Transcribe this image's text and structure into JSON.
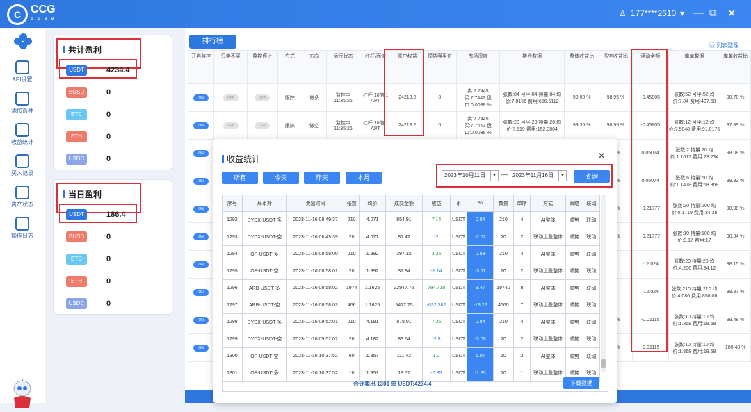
{
  "app": {
    "logo": "CCG",
    "version": "6.1.3.9",
    "user": "177****2610",
    "brand_color": "#2f78e0",
    "alert_color": "#d9303a"
  },
  "nav": [
    {
      "label": "API设置",
      "icon": "gear-icon"
    },
    {
      "label": "添加币种",
      "icon": "coin-add-icon"
    },
    {
      "label": "收益统计",
      "icon": "chart-icon"
    },
    {
      "label": "买入记录",
      "icon": "record-icon"
    },
    {
      "label": "资产状态",
      "icon": "wallet-icon"
    },
    {
      "label": "操作日志",
      "icon": "log-icon"
    }
  ],
  "total_profit": {
    "title": "共计盈利",
    "coins": [
      {
        "name": "USDT",
        "value": "4234.4",
        "color": "#2f78e0"
      },
      {
        "name": "BUSD",
        "value": "0",
        "color": "#f07b6b"
      },
      {
        "name": "BTC",
        "value": "0",
        "color": "#69c7f2"
      },
      {
        "name": "ETH",
        "value": "0",
        "color": "#f07b6b"
      },
      {
        "name": "USDC",
        "value": "0",
        "color": "#8aa5e8"
      }
    ]
  },
  "today_profit": {
    "title": "当日盈利",
    "coins": [
      {
        "name": "USDT",
        "value": "186.4",
        "color": "#2f78e0"
      },
      {
        "name": "BUSD",
        "value": "0",
        "color": "#f07b6b"
      },
      {
        "name": "BTC",
        "value": "0",
        "color": "#69c7f2"
      },
      {
        "name": "ETH",
        "value": "0",
        "color": "#f07b6b"
      },
      {
        "name": "USDC",
        "value": "0",
        "color": "#8aa5e8"
      }
    ]
  },
  "main": {
    "rank_button": "排行榜",
    "list_view": "列表整理",
    "headers": [
      "开启监控",
      "只卖不买",
      "监控停止",
      "方式",
      "方向",
      "运行状态",
      "杠杆/面值",
      "账户权益",
      "预估强平价",
      "市场深度",
      "持仓数据",
      "整体收益比",
      "多空收益比",
      "浮动金额",
      "库单数据",
      "库单收益比"
    ],
    "rows": [
      {
        "mode": "跟踪",
        "dir": "做多",
        "status": "监控中 11:35:26",
        "lev": "杠杆:10倍 1 APT",
        "equity": "24213.2",
        "liq": "0",
        "depth": "卖:7.7445 买:7.7442 盘口:0.0038 %",
        "pos": "张数:84 可平:84 持量:84 均价:7.8156 费用:656.5112",
        "ratio": "99.09 %",
        "ls": "98.95 %",
        "float": "-0.45805",
        "stock": "张数:52 可平:52 均价:7.84 费用:407.68",
        "sr": "98.78 %"
      },
      {
        "mode": "跟踪",
        "dir": "做空",
        "status": "监控中 11:35:26",
        "lev": "杠杆:10倍 1 APT",
        "equity": "24213.2",
        "liq": "0",
        "depth": "卖:7.7445 买:7.7442 盘口:0.0038 %",
        "pos": "张数:20 可平:20 持量:20 均价:7.619 费用:152.3804",
        "ratio": "99.35 %",
        "ls": "98.95 %",
        "float": "-0.45805",
        "stock": "张数:12 可平:12 均价:7.5848 费用:91.0176",
        "sr": "97.89 %"
      },
      {
        "ls": "4 %",
        "float": "0.05074",
        "stock": "张数:2 持量:20 均价:1.1617 费用:23.234",
        "sr": "98.08 %"
      },
      {
        "ls": "4 %",
        "float": "0.05074",
        "stock": "张数:6 持量:60 均价:1.1478 费用:68.868",
        "sr": "99.93 %"
      },
      {
        "ls": "3 %",
        "float": "-0.21777",
        "stock": "张数:20 持量:200 均价:0.1719 费用:34.38",
        "sr": "98.08 %"
      },
      {
        "ls": "3 %",
        "float": "-0.21777",
        "stock": "张数:10 持量:100 均价:0.17 费用:17",
        "sr": "98.84 %"
      },
      {
        "ls": "",
        "float": "-12.024",
        "stock": "张数:20 持量:20 均价:4.206 费用:84.12",
        "sr": "98.15 %"
      },
      {
        "ls": "",
        "float": "-12.024",
        "stock": "张数:210 持量:210 均价:4.086 费用:858.06",
        "sr": "98.87 %"
      },
      {
        "ls": "7 %",
        "float": "-0.01115",
        "stock": "张数:10 持量:10 均价:1.858 费用:18.58",
        "sr": "99.48 %"
      },
      {
        "ls": "7 %",
        "float": "-0.01115",
        "stock": "张数:10 持量:10 均价:1.858 费用:18.58",
        "sr": "100.48 %"
      }
    ]
  },
  "modal": {
    "title": "收益统计",
    "filters": [
      "所有",
      "今天",
      "昨天",
      "本月"
    ],
    "start_date": "2023年10月11日",
    "end_date": "2023年11月16日",
    "query": "查询",
    "headers": [
      "序号",
      "局币对",
      "卖出时间",
      "张数",
      "均价",
      "成交金额",
      "收益",
      "币",
      "%",
      "数量",
      "单序",
      "方式",
      "策略",
      "联动"
    ],
    "rows": [
      [
        "1292",
        "DYDX-USDT-多",
        "2023-11-16 08:49:37",
        "210",
        "4.071",
        "854.91",
        "7.14",
        "USDT",
        "0.84",
        "210",
        "4",
        "AI整体",
        "顺势",
        "联动"
      ],
      [
        "1293",
        "DYDX-USDT-空",
        "2023-11-16 08:49:39",
        "20",
        "4.071",
        "81.42",
        "-2",
        "USDT",
        "-2.52",
        "20",
        "2",
        "联动止盈整体",
        "顺势",
        "联动"
      ],
      [
        "1294",
        "OP-USDT-多",
        "2023-11-16 08:58:00",
        "210",
        "1.892",
        "397.32",
        "3.36",
        "USDT",
        "0.88",
        "210",
        "4",
        "AI整体",
        "顺势",
        "联动"
      ],
      [
        "1295",
        "OP-USDT-空",
        "2023-11-16 08:58:01",
        "20",
        "1.892",
        "37.84",
        "-1.14",
        "USDT",
        "-3.11",
        "20",
        "2",
        "联动止盈整体",
        "顺势",
        "联动"
      ],
      [
        "1296",
        "ARB-USDT-多",
        "2023-11-16 08:58:02",
        "1974",
        "1.1625",
        "22947.75",
        "784.718",
        "USDT",
        "3.47",
        "19740",
        "8",
        "AI整体",
        "顺势",
        "联动"
      ],
      [
        "1297",
        "ARB-USDT-空",
        "2023-11-16 08:58:03",
        "466",
        "1.1625",
        "5417.25",
        "-632.382",
        "USDT",
        "-13.22",
        "4660",
        "7",
        "联动止盈整体",
        "顺势",
        "联动"
      ],
      [
        "1298",
        "DYDX-USDT-多",
        "2023-11-16 09:52:01",
        "210",
        "4.181",
        "878.01",
        "7.35",
        "USDT",
        "0.84",
        "210",
        "4",
        "AI整体",
        "顺势",
        "联动"
      ],
      [
        "1299",
        "DYDX-USDT-空",
        "2023-11-16 09:52:02",
        "20",
        "4.182",
        "83.64",
        "-2.5",
        "USDT",
        "-3.08",
        "20",
        "2",
        "联动止盈整体",
        "顺势",
        "联动"
      ],
      [
        "1300",
        "OP-USDT-空",
        "2023-11-16 10:37:52",
        "60",
        "1.857",
        "111.42",
        "1.2",
        "USDT",
        "1.07",
        "60",
        "3",
        "AI整体",
        "顺势",
        "联动"
      ],
      [
        "1301",
        "OP-USDT-多",
        "2023-11-16 10:37:52",
        "10",
        "1.857",
        "18.57",
        "-0.35",
        "USDT",
        "-1.85",
        "10",
        "1",
        "联动止盈整体",
        "顺势",
        "联动"
      ]
    ],
    "summary": "合计卖出 1301 单   USDT:4234.4",
    "download": "下载数据"
  }
}
